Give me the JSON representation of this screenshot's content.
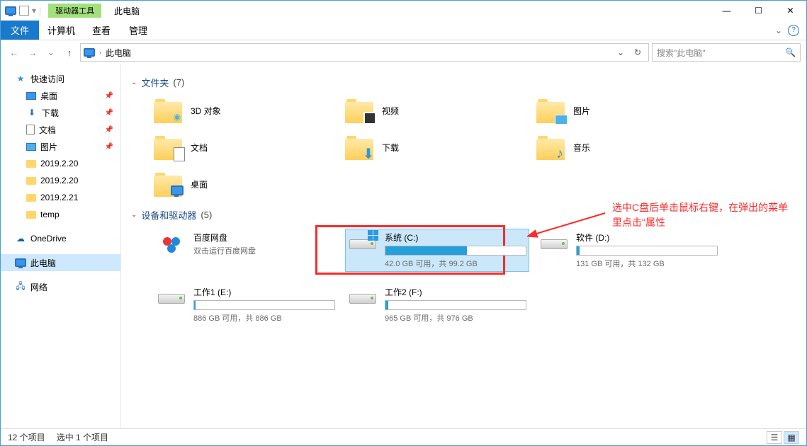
{
  "title": "此电脑",
  "context_tab": "驱动器工具",
  "context_manage": "管理",
  "ribbon": {
    "file": "文件",
    "computer": "计算机",
    "view": "查看"
  },
  "breadcrumb": {
    "root": "此电脑"
  },
  "search": {
    "placeholder": "搜索\"此电脑\""
  },
  "sidebar": {
    "quick": "快速访问",
    "items": {
      "desktop": "桌面",
      "downloads": "下载",
      "documents": "文档",
      "pictures": "图片",
      "f1": "2019.2.20",
      "f2": "2019.2.20",
      "f3": "2019.2.21",
      "f4": "temp"
    },
    "onedrive": "OneDrive",
    "thispc": "此电脑",
    "network": "网络"
  },
  "groups": {
    "folders": {
      "label": "文件夹",
      "count": "(7)"
    },
    "devices": {
      "label": "设备和驱动器",
      "count": "(5)"
    }
  },
  "folders": {
    "objects3d": "3D 对象",
    "videos": "视频",
    "pictures": "图片",
    "documents": "文档",
    "downloads": "下载",
    "music": "音乐",
    "desktop": "桌面"
  },
  "drives": {
    "baidu": {
      "name": "百度网盘",
      "sub": "双击运行百度网盘"
    },
    "c": {
      "name": "系统 (C:)",
      "space": "42.0 GB 可用，共 99.2 GB",
      "fill": 58
    },
    "d": {
      "name": "软件 (D:)",
      "space": "131 GB 可用，共 132 GB",
      "fill": 2
    },
    "e": {
      "name": "工作1 (E:)",
      "space": "886 GB 可用，共 886 GB",
      "fill": 1
    },
    "f": {
      "name": "工作2 (F:)",
      "space": "965 GB 可用，共 976 GB",
      "fill": 2
    }
  },
  "annotation": "选中C盘后单击鼠标右键，在弹出的菜单里点击\"属性",
  "status": {
    "count": "12 个项目",
    "selected": "选中 1 个项目"
  }
}
